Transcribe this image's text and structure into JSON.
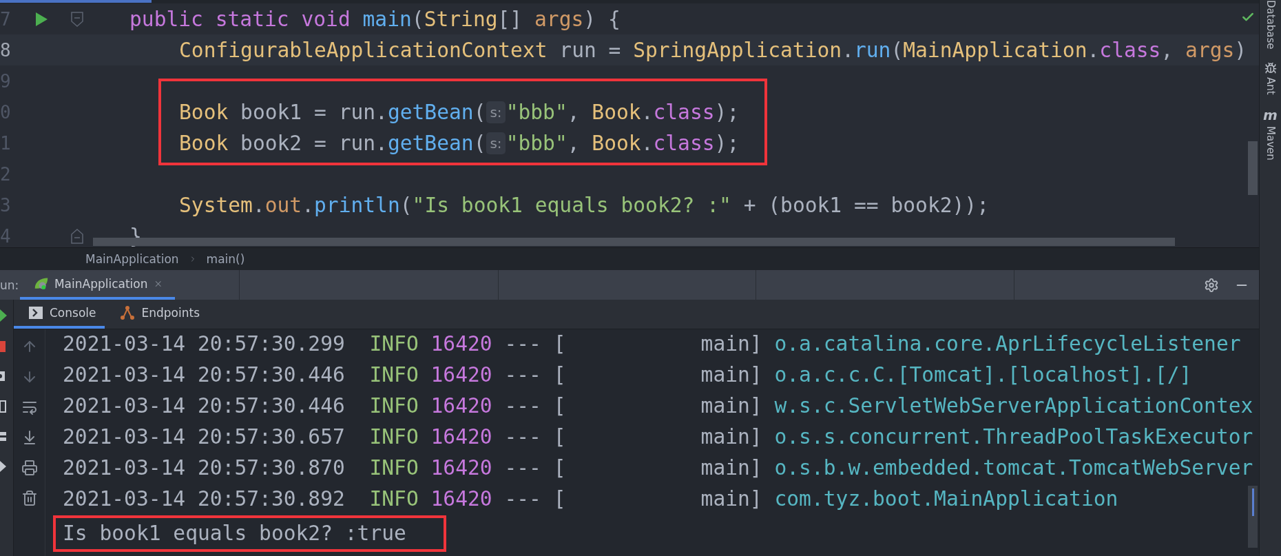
{
  "editor": {
    "lines": [
      {
        "number": "7",
        "run_marker": true,
        "fold_start": true,
        "fold_end": false,
        "current": false,
        "framed": false,
        "indented": false,
        "tokens": [
          {
            "kind": "keyword",
            "text": "public static void "
          },
          {
            "kind": "method",
            "text": "main"
          },
          {
            "kind": "plain",
            "text": "("
          },
          {
            "kind": "type",
            "text": "String"
          },
          {
            "kind": "plain",
            "text": "[] "
          },
          {
            "kind": "param",
            "text": "args"
          },
          {
            "kind": "plain",
            "text": ") {"
          }
        ]
      },
      {
        "number": "8",
        "run_marker": false,
        "fold_start": false,
        "fold_end": false,
        "current": true,
        "framed": false,
        "indented": true,
        "tokens": [
          {
            "kind": "type",
            "text": "ConfigurableApplicationContext"
          },
          {
            "kind": "plain",
            "text": " run = "
          },
          {
            "kind": "type",
            "text": "SpringApplication"
          },
          {
            "kind": "plain",
            "text": "."
          },
          {
            "kind": "method",
            "text": "run"
          },
          {
            "kind": "plain",
            "text": "("
          },
          {
            "kind": "type",
            "text": "MainApplication"
          },
          {
            "kind": "plain",
            "text": "."
          },
          {
            "kind": "keyword",
            "text": "class"
          },
          {
            "kind": "plain",
            "text": ", "
          },
          {
            "kind": "param",
            "text": "args"
          },
          {
            "kind": "plain",
            "text": ")"
          }
        ]
      },
      {
        "number": "9",
        "run_marker": false,
        "fold_start": false,
        "fold_end": false,
        "current": false,
        "framed": false
      },
      {
        "number": "0",
        "run_marker": false,
        "fold_start": false,
        "fold_end": false,
        "current": false,
        "framed": true,
        "indented": true,
        "tokens": [
          {
            "kind": "type",
            "text": "Book"
          },
          {
            "kind": "plain",
            "text": " book1 = run."
          },
          {
            "kind": "method",
            "text": "getBean"
          },
          {
            "kind": "plain",
            "text": "("
          },
          {
            "kind": "hint",
            "text": "s:"
          },
          {
            "kind": "string",
            "text": "\"bbb\""
          },
          {
            "kind": "plain",
            "text": ", "
          },
          {
            "kind": "type",
            "text": "Book"
          },
          {
            "kind": "plain",
            "text": "."
          },
          {
            "kind": "keyword",
            "text": "class"
          },
          {
            "kind": "plain",
            "text": ");"
          }
        ]
      },
      {
        "number": "1",
        "run_marker": false,
        "fold_start": false,
        "fold_end": false,
        "current": false,
        "framed": true,
        "indented": true,
        "tokens": [
          {
            "kind": "type",
            "text": "Book"
          },
          {
            "kind": "plain",
            "text": " book2 = run."
          },
          {
            "kind": "method",
            "text": "getBean"
          },
          {
            "kind": "plain",
            "text": "("
          },
          {
            "kind": "hint",
            "text": "s:"
          },
          {
            "kind": "string",
            "text": "\"bbb\""
          },
          {
            "kind": "plain",
            "text": ", "
          },
          {
            "kind": "type",
            "text": "Book"
          },
          {
            "kind": "plain",
            "text": "."
          },
          {
            "kind": "keyword",
            "text": "class"
          },
          {
            "kind": "plain",
            "text": ");"
          }
        ]
      },
      {
        "number": "2",
        "run_marker": false,
        "fold_start": false,
        "fold_end": false,
        "current": false,
        "framed": false
      },
      {
        "number": "3",
        "run_marker": false,
        "fold_start": false,
        "fold_end": false,
        "current": false,
        "framed": false,
        "indented": true,
        "tokens": [
          {
            "kind": "type",
            "text": "System"
          },
          {
            "kind": "plain",
            "text": "."
          },
          {
            "kind": "field",
            "text": "out"
          },
          {
            "kind": "plain",
            "text": "."
          },
          {
            "kind": "method",
            "text": "println"
          },
          {
            "kind": "plain",
            "text": "("
          },
          {
            "kind": "string",
            "text": "\"Is book1 equals book2? :\""
          },
          {
            "kind": "plain",
            "text": " + (book1 == book2));"
          }
        ]
      },
      {
        "number": "4",
        "run_marker": false,
        "fold_start": false,
        "fold_end": true,
        "current": false,
        "framed": false,
        "indented": false,
        "tokens": [
          {
            "kind": "plain",
            "text": "}"
          }
        ]
      }
    ]
  },
  "breadcrumbs": [
    "MainApplication",
    "main()"
  ],
  "run_panel": {
    "label": "un:",
    "tabs": [
      {
        "label": "MainApplication",
        "selected": true
      }
    ],
    "tool_tabs": [
      {
        "label": "Console",
        "kind": "console",
        "selected": true
      },
      {
        "label": "Endpoints",
        "kind": "endpoints",
        "selected": false
      }
    ],
    "console": {
      "lines": [
        {
          "kind": "log",
          "time": "2021-03-14 20:57:30.299",
          "level": "INFO",
          "pid": "16420",
          "separator": "--- [",
          "thread": "main]",
          "logger": "o.a.catalina.core.AprLifecycleListener",
          "framed": false
        },
        {
          "kind": "log",
          "time": "2021-03-14 20:57:30.446",
          "level": "INFO",
          "pid": "16420",
          "separator": "--- [",
          "thread": "main]",
          "logger": "o.a.c.c.C.[Tomcat].[localhost].[/]",
          "framed": false
        },
        {
          "kind": "log",
          "time": "2021-03-14 20:57:30.446",
          "level": "INFO",
          "pid": "16420",
          "separator": "--- [",
          "thread": "main]",
          "logger": "w.s.c.ServletWebServerApplicationContex",
          "framed": false
        },
        {
          "kind": "log",
          "time": "2021-03-14 20:57:30.657",
          "level": "INFO",
          "pid": "16420",
          "separator": "--- [",
          "thread": "main]",
          "logger": "o.s.s.concurrent.ThreadPoolTaskExecutor",
          "framed": false
        },
        {
          "kind": "log",
          "time": "2021-03-14 20:57:30.870",
          "level": "INFO",
          "pid": "16420",
          "separator": "--- [",
          "thread": "main]",
          "logger": "o.s.b.w.embedded.tomcat.TomcatWebServer",
          "framed": false
        },
        {
          "kind": "log",
          "time": "2021-03-14 20:57:30.892",
          "level": "INFO",
          "pid": "16420",
          "separator": "--- [",
          "thread": "main]",
          "logger": "com.tyz.boot.MainApplication",
          "framed": false
        },
        {
          "kind": "output",
          "text": "Is book1 equals book2? :true",
          "framed": true
        }
      ]
    }
  },
  "right_toolbar": [
    {
      "label": "Database",
      "kind": "database"
    },
    {
      "label": "Ant",
      "kind": "ant"
    },
    {
      "label": "Maven",
      "kind": "maven",
      "icon_text": "m"
    }
  ]
}
